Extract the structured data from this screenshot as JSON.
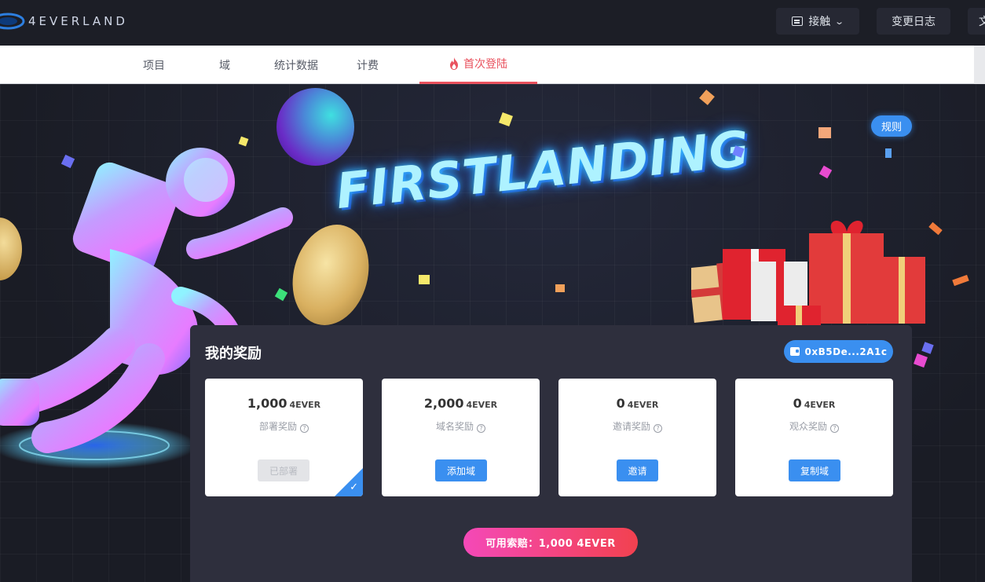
{
  "app": {
    "logo_text": "4EVERLAND"
  },
  "header": {
    "contact_label": "接触",
    "changelog_label": "变更日志",
    "lang_label": "文"
  },
  "nav": {
    "items": [
      {
        "label": "项目"
      },
      {
        "label": "域"
      },
      {
        "label": "统计数据"
      },
      {
        "label": "计费"
      },
      {
        "label": "首次登陆",
        "active": true
      }
    ]
  },
  "hero": {
    "rules_label": "规则",
    "headline": "FIRSTLANDING"
  },
  "rewards": {
    "title": "我的奖励",
    "wallet_address": "0xB5De...2A1c",
    "cards": [
      {
        "amount": "1,000",
        "unit": "4EVER",
        "label": "部署奖励",
        "button": "已部署",
        "state": "done"
      },
      {
        "amount": "2,000",
        "unit": "4EVER",
        "label": "域名奖励",
        "button": "添加域",
        "state": "active"
      },
      {
        "amount": "0",
        "unit": "4EVER",
        "label": "邀请奖励",
        "button": "邀请",
        "state": "active"
      },
      {
        "amount": "0",
        "unit": "4EVER",
        "label": "观众奖励",
        "button": "复制域",
        "state": "active"
      }
    ],
    "claim_label": "可用索赔：1,000 4EVER"
  },
  "colors": {
    "accent_blue": "#3a8ff0",
    "active_red": "#e9515d",
    "claim_gradient_start": "#f449b8",
    "claim_gradient_end": "#f2414f"
  }
}
